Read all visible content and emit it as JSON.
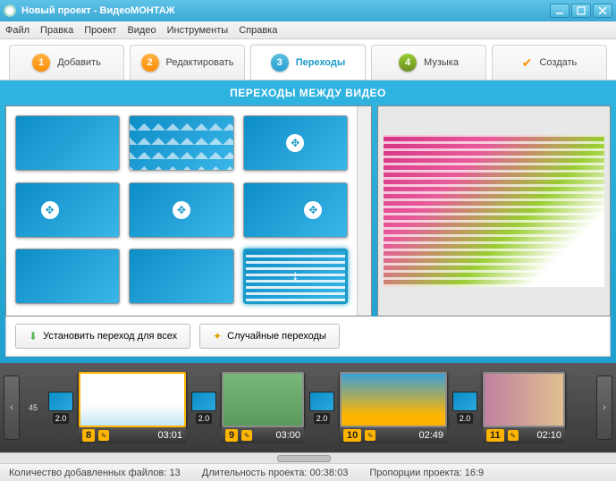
{
  "window": {
    "title": "Новый проект - ВидеоМОНТАЖ"
  },
  "menu": {
    "file": "Файл",
    "edit": "Правка",
    "project": "Проект",
    "video": "Видео",
    "tools": "Инструменты",
    "help": "Справка"
  },
  "tabs": {
    "add": {
      "num": "1",
      "label": "Добавить"
    },
    "edit": {
      "num": "2",
      "label": "Редактировать"
    },
    "trans": {
      "num": "3",
      "label": "Переходы"
    },
    "music": {
      "num": "4",
      "label": "Музыка"
    },
    "make": {
      "label": "Создать"
    }
  },
  "section_title": "ПЕРЕХОДЫ МЕЖДУ ВИДЕО",
  "buttons": {
    "apply_all": "Установить переход для всех",
    "random": "Случайные переходы"
  },
  "timeline": {
    "first_index": "45",
    "trans_dur": "2.0",
    "clips": [
      {
        "idx": "8",
        "dur": "03:01"
      },
      {
        "idx": "9",
        "dur": "03:00"
      },
      {
        "idx": "10",
        "dur": "02:49"
      },
      {
        "idx": "11",
        "dur": "02:10"
      }
    ]
  },
  "status": {
    "files_label": "Количество добавленных файлов:",
    "files_value": "13",
    "duration_label": "Длительность проекта:",
    "duration_value": "00:38:03",
    "aspect_label": "Пропорции проекта:",
    "aspect_value": "16:9"
  }
}
